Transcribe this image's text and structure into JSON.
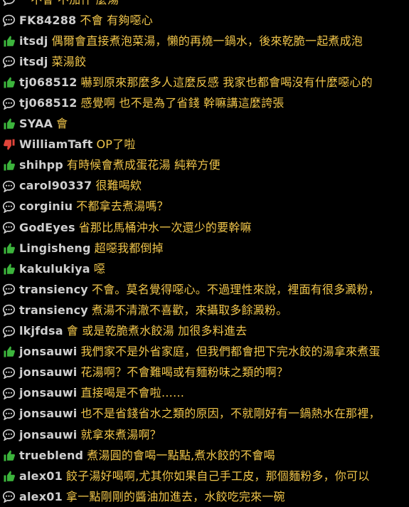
{
  "colors": {
    "background": "#000000",
    "user": "#cfcfcf",
    "content": "#f0c54a",
    "push": "#3cb43c",
    "boo": "#e0443a",
    "arrow": "#cfcfcf"
  },
  "comments": [
    {
      "type": "arrow",
      "icon": "comment-icon",
      "user": "",
      "content": "一不會 不加什 麼湯"
    },
    {
      "type": "arrow",
      "icon": "comment-icon",
      "user": "FK84288",
      "content": "不會 有夠噁心"
    },
    {
      "type": "push",
      "icon": "thumbs-up-icon",
      "user": "itsdj",
      "content": "偶爾會直接煮泡菜湯，懶的再燒一鍋水，後來乾脆一起煮成泡"
    },
    {
      "type": "arrow",
      "icon": "comment-icon",
      "user": "itsdj",
      "content": "菜湯餃"
    },
    {
      "type": "push",
      "icon": "thumbs-up-icon",
      "user": "tj068512",
      "content": "嚇到原來那麼多人這麼反感 我家也都會喝沒有什麼噁心的"
    },
    {
      "type": "arrow",
      "icon": "comment-icon",
      "user": "tj068512",
      "content": "感覺啊 也不是為了省錢 幹嘛講這麼誇張"
    },
    {
      "type": "push",
      "icon": "thumbs-up-icon",
      "user": "SYAA",
      "content": "會"
    },
    {
      "type": "boo",
      "icon": "thumbs-down-icon",
      "user": "WilliamTaft",
      "content": "OP了啦"
    },
    {
      "type": "push",
      "icon": "thumbs-up-icon",
      "user": "shihpp",
      "content": "有時候會煮成蛋花湯 純粹方便"
    },
    {
      "type": "arrow",
      "icon": "comment-icon",
      "user": "carol90337",
      "content": "很難喝欸"
    },
    {
      "type": "arrow",
      "icon": "comment-icon",
      "user": "corginiu",
      "content": "不都拿去煮湯嗎？"
    },
    {
      "type": "arrow",
      "icon": "comment-icon",
      "user": "GodEyes",
      "content": "省那比馬桶沖水一次還少的要幹嘛"
    },
    {
      "type": "push",
      "icon": "thumbs-up-icon",
      "user": "Lingisheng",
      "content": "超噁我都倒掉"
    },
    {
      "type": "push",
      "icon": "thumbs-up-icon",
      "user": "kakulukiya",
      "content": "噁"
    },
    {
      "type": "arrow",
      "icon": "comment-icon",
      "user": "transiency",
      "content": "不會。莫名覺得噁心。不過理性來說，裡面有很多澱粉，"
    },
    {
      "type": "arrow",
      "icon": "comment-icon",
      "user": "transiency",
      "content": "煮湯不清澈不喜歡，來攝取多餘澱粉。"
    },
    {
      "type": "arrow",
      "icon": "comment-icon",
      "user": "lkjfdsa",
      "content": "會 或是乾脆煮水餃湯 加很多料進去"
    },
    {
      "type": "push",
      "icon": "thumbs-up-icon",
      "user": "jonsauwi",
      "content": "我們家不是外省家庭，但我們都會把下完水餃的湯拿來煮蛋"
    },
    {
      "type": "arrow",
      "icon": "comment-icon",
      "user": "jonsauwi",
      "content": "花湯啊？不會難喝或有麵粉味之類的啊？"
    },
    {
      "type": "arrow",
      "icon": "comment-icon",
      "user": "jonsauwi",
      "content": "直接喝是不會啦……"
    },
    {
      "type": "arrow",
      "icon": "comment-icon",
      "user": "jonsauwi",
      "content": "也不是省錢省水之類的原因，不就剛好有一鍋熱水在那裡，"
    },
    {
      "type": "arrow",
      "icon": "comment-icon",
      "user": "jonsauwi",
      "content": "就拿來煮湯啊？"
    },
    {
      "type": "push",
      "icon": "thumbs-up-icon",
      "user": "trueblend",
      "content": "煮湯圓的會喝一點點,煮水餃的不會喝"
    },
    {
      "type": "push",
      "icon": "thumbs-up-icon",
      "user": "alex01",
      "content": "餃子湯好喝啊,尤其你如果自己手工皮，那個麵粉多，你可以"
    },
    {
      "type": "arrow",
      "icon": "comment-icon",
      "user": "alex01",
      "content": "拿一點剛剛的醬油加進去，水餃吃完來一碗"
    }
  ]
}
